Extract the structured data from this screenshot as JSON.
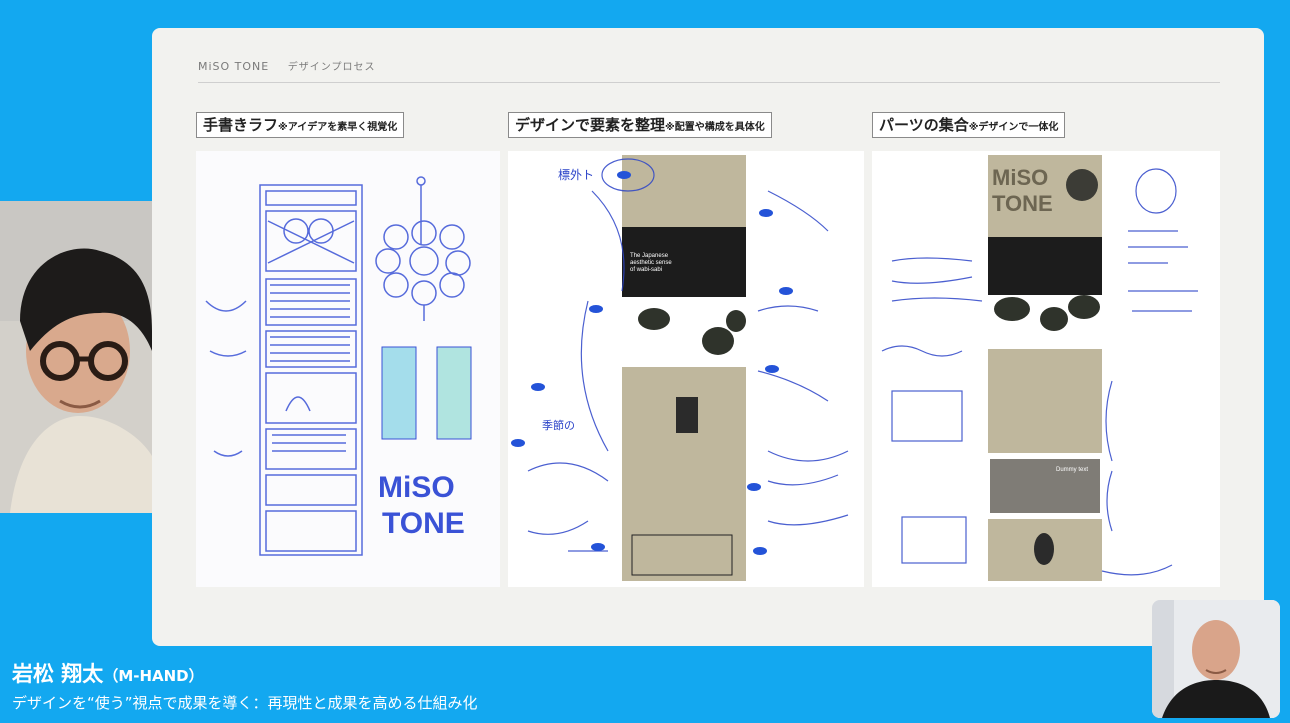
{
  "slide": {
    "brand": "MiSO TONE",
    "section": "デザインプロセス",
    "columns": [
      {
        "title": "手書きラフ",
        "note": "※アイデアを素早く視覚化"
      },
      {
        "title": "デザインで要素を整理",
        "note": "※配置や構成を具体化"
      },
      {
        "title": "パーツの集合",
        "note": "※デザインで一体化"
      }
    ],
    "sketch": {
      "logo_line1": "MiSO",
      "logo_line2": "TONE",
      "label1": "標外ト",
      "label2": "季節の"
    },
    "mock": {
      "hero_text_line1": "The Japanese",
      "hero_text_line2": "aesthetic sense",
      "hero_text_line3": "of wabi-sabi",
      "logo_line1": "MiSO",
      "logo_line2": "TONE",
      "dummy": "Dummy text"
    }
  },
  "speaker": {
    "name": "岩松 翔太",
    "org": "（M-HAND）",
    "talk_title": "デザインを“使う”視点で成果を導く：再現性と成果を高める仕組み化"
  },
  "colors": {
    "background": "#13a8f0",
    "slide": "#f2f2ef",
    "sketch_blue": "#3a52d6"
  }
}
